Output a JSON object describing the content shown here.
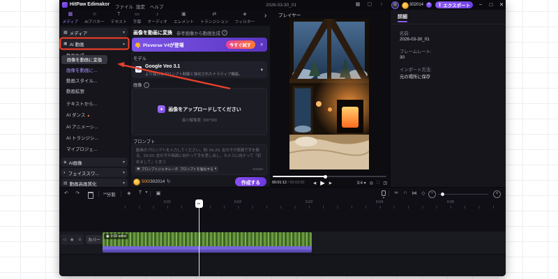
{
  "colors": {
    "accent": "#8b5cf6",
    "annotation_red": "#e8402c",
    "banner_purple": "#7b54e8",
    "cta_gradient": "#e8439b→#ff7a2e",
    "coin_gold": "#f0b432",
    "clip_green": "#5f8f38",
    "clip_audio_purple": "#6f5ed6",
    "selected_text": "#a98ff7"
  },
  "icons": {
    "caret_down": "▾",
    "caret_up": "▴",
    "close": "✕",
    "chevron_right": "›",
    "undo": "↶",
    "redo": "↷",
    "scissors": "✂",
    "link": "∞",
    "magnet": "∩",
    "chain": "⋈",
    "keyframe": "◇",
    "shield": "◈",
    "text_tool": "T",
    "frame": "▣",
    "snapshot": "◎",
    "grid": "∷",
    "fullscreen": "◳",
    "refresh": "↻",
    "play": "▶",
    "prev": "◀",
    "next": "▶",
    "plus": "+",
    "minus": "−",
    "maximize": "□",
    "export_arrow": "↥",
    "download": "↓",
    "layout": "▦",
    "chat": "▢",
    "fire": "▲",
    "thumb": "▣",
    "speaker": "◁",
    "eye": "◉",
    "lock": "⊙"
  },
  "titlebar": {
    "app_name": "HitPaw Edimakor",
    "menus": [
      {
        "label": "ファイル"
      },
      {
        "label": "設定"
      },
      {
        "label": "ヘルプ"
      }
    ],
    "project_name": "2026-03-30_01",
    "credits": "302014",
    "export_label": "エクスポート"
  },
  "tabs": {
    "items": [
      {
        "icon": "▦",
        "label": "メディア"
      },
      {
        "icon": "☺",
        "label": "AIアバター"
      },
      {
        "icon": "T",
        "label": "テキスト"
      },
      {
        "icon": "▭",
        "label": "字幕"
      },
      {
        "icon": "♪",
        "label": "オーディオ"
      },
      {
        "icon": "▣",
        "label": "エレメント"
      },
      {
        "icon": "⇄",
        "label": "トランジション"
      },
      {
        "icon": "◈",
        "label": "フィルター"
      }
    ]
  },
  "sidebar": {
    "sections": [
      {
        "icon": "▦",
        "label": "メディア"
      },
      {
        "icon": "▣",
        "label": "AI 動画"
      },
      {
        "icon": "◈",
        "label": "AI画像"
      },
      {
        "icon": "◐",
        "label": "フェイススワ..."
      },
      {
        "icon": "▤",
        "label": "動画高画質化"
      }
    ],
    "ai_video_items": [
      {
        "label": "動画生成..."
      },
      {
        "label": "画像を動画に..."
      },
      {
        "label": "動画スタイル..."
      },
      {
        "label": "動画拡張"
      },
      {
        "label": "テキストから..."
      },
      {
        "label": "AI ダンス"
      },
      {
        "label": "AI アニメーシ..."
      },
      {
        "label": "AI トランジシ..."
      },
      {
        "label": "マイプロジェ..."
      }
    ],
    "tooltip": "画像を動画に変換"
  },
  "main": {
    "tab_active": "画像を動画に変換",
    "tab_secondary": "参考画像から動画生成",
    "banner": {
      "text": "Pixverse V4が登場",
      "cta": "今すぐ試す"
    },
    "model_label": "モデル",
    "model_name": "Google Veo 3.1",
    "model_desc": "より強力なプロンプト制御と強化されたナラティブ機能。",
    "image_label": "画像",
    "upload_title": "画像をアップロードしてください",
    "upload_hint": "最小解像度: 300*300",
    "prompt_label": "プロンプト",
    "prompt_placeholder": "動画のプロンプトを入力してください。例: 0S-2S: 女の子が笑顔で手を振る、2S-5S: 女の子が画面に向かって手を差し出し、カメラに向かって「初めまして」と言う",
    "prompt_tool_1": "プロンプトジェネレーター",
    "prompt_tool_2": "プロンプトを強化する",
    "char_count": "0/2000",
    "credits_used": "500",
    "credits_total": "/302014",
    "create_label": "作成する"
  },
  "player": {
    "title": "プレイヤー",
    "current_time": "00:01:12",
    "total_time": " / 00:03:00",
    "aspect_ratio": "3:4"
  },
  "details": {
    "tab": "詳細",
    "fields": [
      {
        "label": "名前:",
        "value": "2026-03-30_01"
      },
      {
        "label": "フレームレート:",
        "value": "30"
      },
      {
        "label": "インポート方法:",
        "value": "元の場所に保存"
      }
    ]
  },
  "timeline": {
    "split_label": "分割",
    "ruler": [
      "0:01",
      "0:02",
      "0:03",
      "0:04",
      "0:05"
    ],
    "cover_label": "カバー",
    "clip_label": "0:03 sdhd"
  }
}
